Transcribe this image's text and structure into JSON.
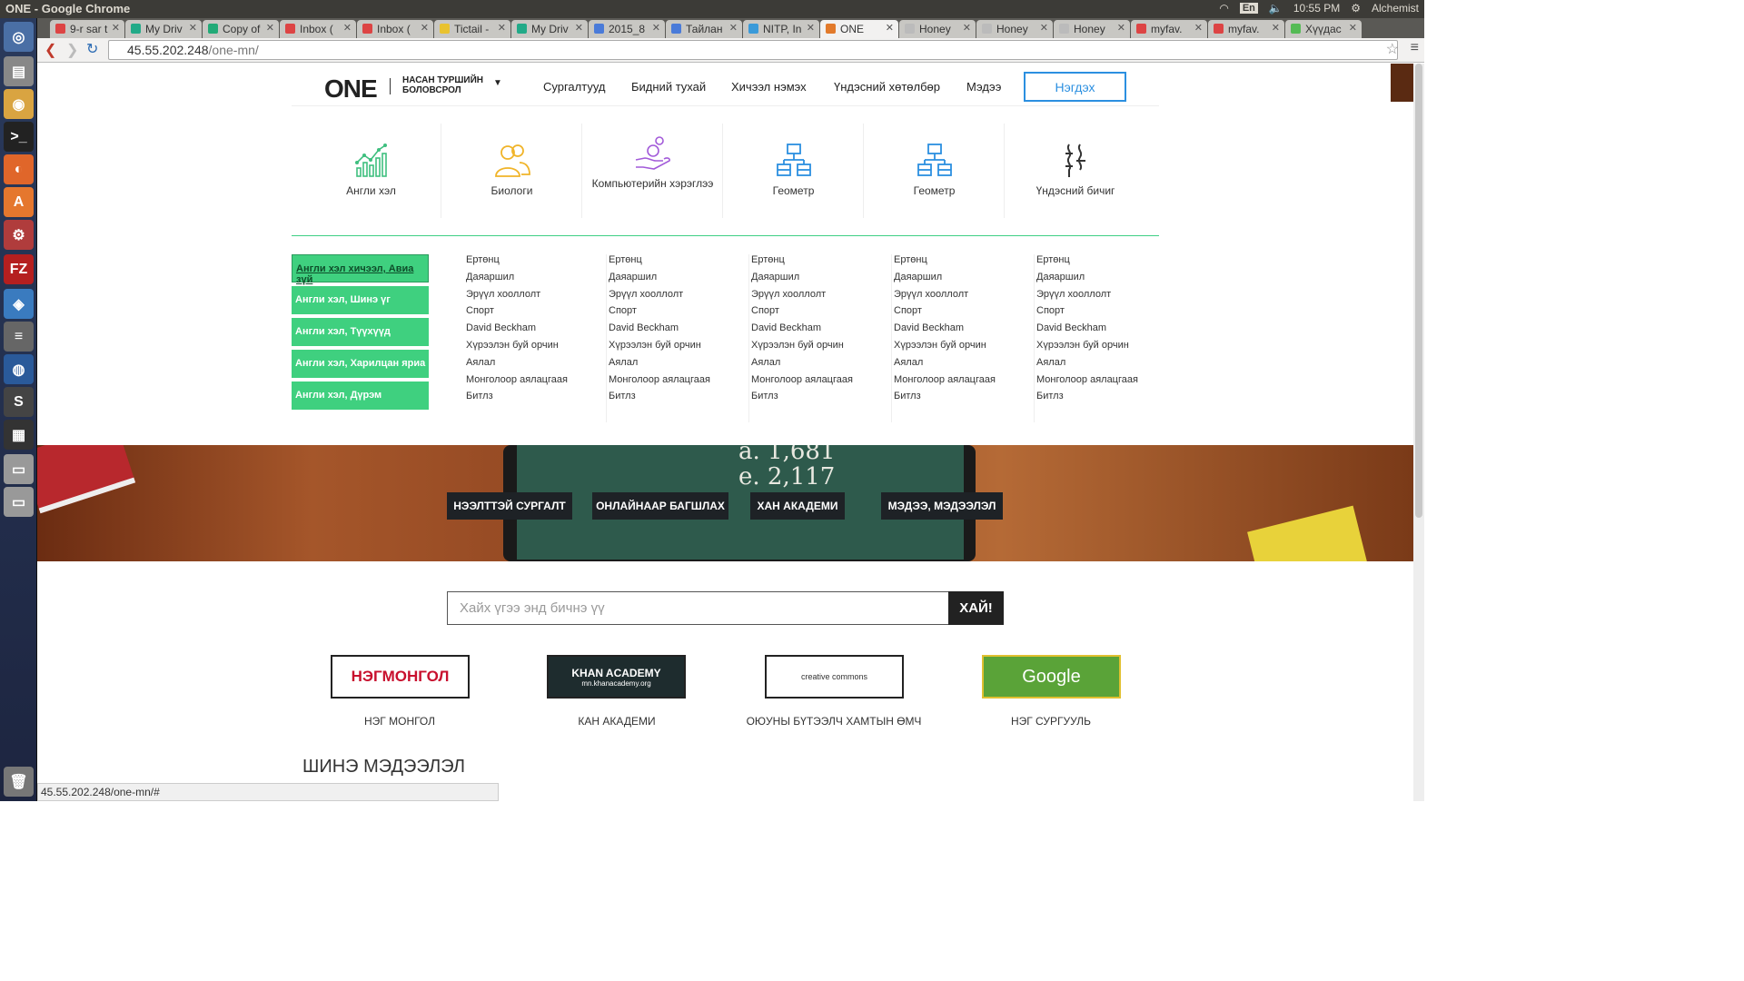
{
  "os": {
    "window_title": "ONE - Google Chrome",
    "lang": "En",
    "clock": "10:55 PM",
    "user": "Alchemist"
  },
  "tabs": [
    {
      "label": "9-r sar t",
      "color": "#d44"
    },
    {
      "label": "My Driv",
      "color": "#2a8"
    },
    {
      "label": "Copy of",
      "color": "#2a7"
    },
    {
      "label": "Inbox (",
      "color": "#d44"
    },
    {
      "label": "Inbox (",
      "color": "#d44"
    },
    {
      "label": "Tictail -",
      "color": "#e9c22e"
    },
    {
      "label": "My Driv",
      "color": "#2a8"
    },
    {
      "label": "2015_8",
      "color": "#4a7bd9"
    },
    {
      "label": "Тайлан",
      "color": "#4a7bd9"
    },
    {
      "label": "NITP, In",
      "color": "#3a9ad9"
    },
    {
      "label": "ONE",
      "color": "#e27a2b",
      "active": true
    },
    {
      "label": "Honey",
      "color": "#bbb"
    },
    {
      "label": "Honey",
      "color": "#bbb"
    },
    {
      "label": "Honey",
      "color": "#bbb"
    },
    {
      "label": "myfav.",
      "color": "#d44"
    },
    {
      "label": "myfav.",
      "color": "#d44"
    },
    {
      "label": "Хүүдас",
      "color": "#5b5"
    }
  ],
  "address": {
    "host": "45.55.202.248",
    "path": "/one-mn/"
  },
  "site": {
    "logo": "ONE",
    "logo_sub": "НАСАН ТУРШИЙН БОЛОВСРОЛ",
    "nav": [
      "Сургалтууд",
      "Бидний тухай",
      "Хичээл нэмэх",
      "Үндэсний хөтөлбөр",
      "Мэдээ"
    ],
    "login": "Нэгдэх"
  },
  "subjects": [
    {
      "label": "Англи хэл",
      "icon": "chart-icon",
      "color": "#3fbf7f"
    },
    {
      "label": "Биологи",
      "icon": "people-icon",
      "color": "#f0b429"
    },
    {
      "label": "Компьютерийн хэрэглээ",
      "icon": "hand-coin-icon",
      "color": "#a25ad9"
    },
    {
      "label": "Геометр",
      "icon": "hierarchy-icon",
      "color": "#2b8fe0"
    },
    {
      "label": "Геометр",
      "icon": "hierarchy-icon",
      "color": "#2b8fe0"
    },
    {
      "label": "Үндэсний бичиг",
      "icon": "mongol-script-icon",
      "color": "#333333"
    }
  ],
  "courses": [
    "Англи хэл хичээл, Авиа зүй",
    "Англи хэл, Шинэ үг",
    "Англи хэл, Түүхүүд",
    "Англи хэл, Харилцан яриа",
    "Англи хэл, Дүрэм"
  ],
  "topics": [
    "Ертөнц",
    "Даяаршил",
    "Эрүүл хооллолт",
    "Спорт",
    "David Beckham",
    "Хүрээлэн буй орчин",
    "Аялал",
    "Монголоор аялацгаая",
    "Битлз"
  ],
  "banner": {
    "formula1": "a. 1,681",
    "formula2": "e. 2,117",
    "buttons": [
      "НЭЭЛТТЭЙ СУРГАЛТ",
      "ОНЛАЙНААР БАГШЛАХ",
      "ХАН АКАДЕМИ",
      "МЭДЭЭ, МЭДЭЭЛЭЛ"
    ]
  },
  "search": {
    "placeholder": "Хайх үгээ энд бичнэ үү",
    "button": "ХАЙ!"
  },
  "partners": [
    {
      "logo_text": "НЭГМОНГОЛ",
      "caption": "НЭГ МОНГОЛ"
    },
    {
      "logo_text": "KHAN ACADEMY",
      "logo_sub": "mn.khanacademy.org",
      "caption": "КАН АКАДЕМИ"
    },
    {
      "logo_text": "creative commons",
      "caption": "ОЮУНЫ БҮТЭЭЛЧ ХАМТЫН ӨМЧ"
    },
    {
      "logo_text": "Google",
      "caption": "НЭГ СУРГУУЛЬ"
    }
  ],
  "news_title": "ШИНЭ МЭДЭЭЛЭЛ",
  "status_url": "45.55.202.248/one-mn/#"
}
